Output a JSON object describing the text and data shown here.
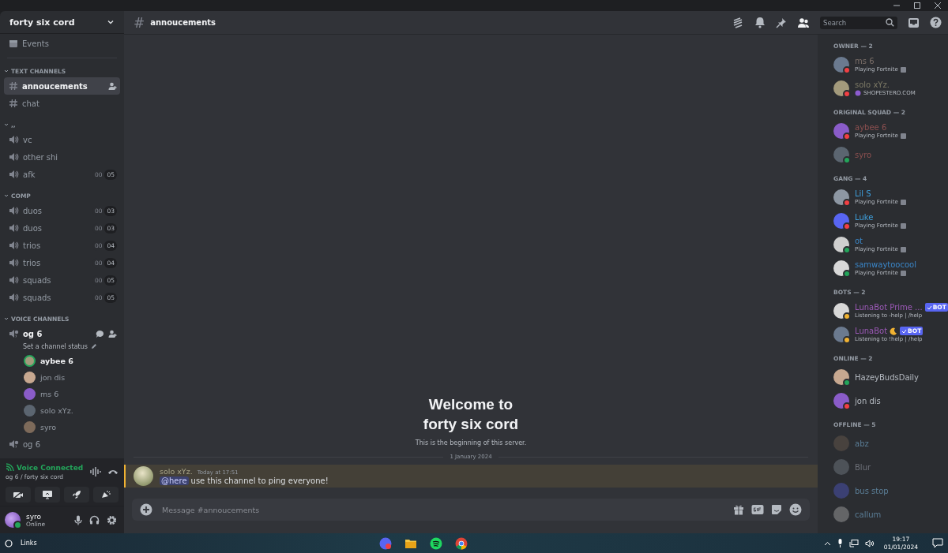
{
  "server": {
    "name": "forty six cord",
    "events": "Events"
  },
  "categories": [
    {
      "name": "TEXT CHANNELS",
      "channels": [
        {
          "kind": "text",
          "name": "annoucements",
          "selected": true
        },
        {
          "kind": "text",
          "name": "chat",
          "selected": false
        }
      ]
    },
    {
      "name": ",,",
      "channels": [
        {
          "kind": "voice",
          "name": "vc",
          "selected": false
        },
        {
          "kind": "voice",
          "name": "other shi",
          "selected": false
        },
        {
          "kind": "voice",
          "name": "afk",
          "selected": false,
          "counts": [
            "00",
            "05"
          ]
        }
      ]
    },
    {
      "name": "COMP",
      "channels": [
        {
          "kind": "voice",
          "name": "duos",
          "selected": false,
          "counts": [
            "00",
            "03"
          ]
        },
        {
          "kind": "voice",
          "name": "duos",
          "selected": false,
          "counts": [
            "00",
            "03"
          ]
        },
        {
          "kind": "voice",
          "name": "trios",
          "selected": false,
          "counts": [
            "00",
            "04"
          ]
        },
        {
          "kind": "voice",
          "name": "trios",
          "selected": false,
          "counts": [
            "00",
            "04"
          ]
        },
        {
          "kind": "voice",
          "name": "squads",
          "selected": false,
          "counts": [
            "00",
            "05"
          ]
        },
        {
          "kind": "voice",
          "name": "squads",
          "selected": false,
          "counts": [
            "00",
            "05"
          ]
        }
      ]
    },
    {
      "name": "VOICE CHANNELS",
      "channels": [
        {
          "kind": "stage",
          "name": "og 6",
          "selected": true,
          "status_hint": "Set a channel status",
          "users": [
            {
              "name": "aybee 6",
              "speaking": true
            },
            {
              "name": "jon dis",
              "speaking": false
            },
            {
              "name": "ms 6",
              "speaking": false
            },
            {
              "name": "solo xYz.",
              "speaking": false
            },
            {
              "name": "syro",
              "speaking": false
            }
          ]
        },
        {
          "kind": "stage",
          "name": "og 6",
          "selected": false
        }
      ]
    }
  ],
  "voice": {
    "status": "Voice Connected",
    "location": "og 6 / forty six cord"
  },
  "user": {
    "name": "syro",
    "status": "Online"
  },
  "channel": {
    "hash": "#",
    "name": "annoucements",
    "search_placeholder": "Search"
  },
  "welcome": {
    "title": "Welcome to\nforty six cord",
    "subtitle": "This is the beginning of this server.",
    "date": "1 January 2024"
  },
  "messages": [
    {
      "author": "solo xYz.",
      "time": "Today at 17:51",
      "mention": "@here",
      "text": "use this channel to ping everyone!",
      "highlighted": true
    }
  ],
  "composer": {
    "placeholder": "Message #annoucements"
  },
  "member_groups": [
    {
      "title": "OWNER — 2",
      "offline": false,
      "members": [
        {
          "name": {
            "text": "ms 6",
            "color": "#7a6e68"
          },
          "status_dot": {
            "color": "#f23f43"
          },
          "activity": "Playing Fortnite",
          "game_icon": true
        },
        {
          "name": {
            "text": "solo xYz.",
            "color": "#7d7a66"
          },
          "status_dot": {
            "color": "#f23f43"
          },
          "activity": "SHOPESTERO.COM",
          "custom_icon": true
        }
      ]
    },
    {
      "title": "ORIGINAL SQUAD — 2",
      "offline": false,
      "members": [
        {
          "name": {
            "text": "aybee 6",
            "color": "#8c5050"
          },
          "status_dot": {
            "color": "#f23f43"
          },
          "activity": "Playing Fortnite",
          "game_icon": true
        },
        {
          "name": {
            "text": "syro",
            "color": "#8c5050"
          },
          "status_dot": {
            "color": "#23a55a"
          }
        }
      ]
    },
    {
      "title": "GANG — 4",
      "offline": false,
      "members": [
        {
          "name": {
            "text": "Lil S",
            "color": "#3e9fdc"
          },
          "status_dot": {
            "color": "#f23f43"
          },
          "activity": "Playing Fortnite",
          "game_icon": true
        },
        {
          "name": {
            "text": "Luke",
            "color": "#3e9fdc"
          },
          "status_dot": {
            "color": "#f23f43"
          },
          "activity": "Playing Fortnite",
          "game_icon": true
        },
        {
          "name": {
            "text": "ot",
            "color": "#3a86c8"
          },
          "status_dot": {
            "color": "#23a55a"
          },
          "activity": "Playing Fortnite",
          "game_icon": true
        },
        {
          "name": {
            "text": "samwaytoocool",
            "color": "#3a86c8"
          },
          "status_dot": {
            "color": "#23a55a"
          },
          "activity": "Playing Fortnite",
          "game_icon": true
        }
      ]
    },
    {
      "title": "BOTS — 2",
      "offline": false,
      "members": [
        {
          "name": {
            "text": "LunaBot Prime ...",
            "color": "#9b59b6"
          },
          "status_dot": {
            "color": "#f0b232"
          },
          "badge": "BOT",
          "activity": "Listening to -help | /help"
        },
        {
          "name": {
            "text": "LunaBot",
            "color": "#9b59b6"
          },
          "status_dot": {
            "color": "#f0b232"
          },
          "badge": "BOT",
          "activity": "Listening to !help | /help"
        }
      ]
    },
    {
      "title": "ONLINE — 2",
      "offline": false,
      "members": [
        {
          "name": {
            "text": "HazeyBudsDaily",
            "color": "#b5bac1"
          },
          "status_dot": {
            "color": "#23a55a"
          }
        },
        {
          "name": {
            "text": "jon dis",
            "color": "#b5bac1"
          },
          "status_dot": {
            "color": "#f23f43"
          }
        }
      ]
    },
    {
      "title": "OFFLINE — 5",
      "offline": true,
      "members": [
        {
          "name": {
            "text": "abz",
            "color": "#5a7d96"
          }
        },
        {
          "name": {
            "text": "Blur",
            "color": "#6d7078"
          }
        },
        {
          "name": {
            "text": "bus stop",
            "color": "#5a7d96"
          }
        },
        {
          "name": {
            "text": "callum",
            "color": "#5a7d96"
          }
        }
      ]
    }
  ],
  "taskbar": {
    "search": "Links",
    "time": "19:17",
    "date": "01/01/2024"
  }
}
